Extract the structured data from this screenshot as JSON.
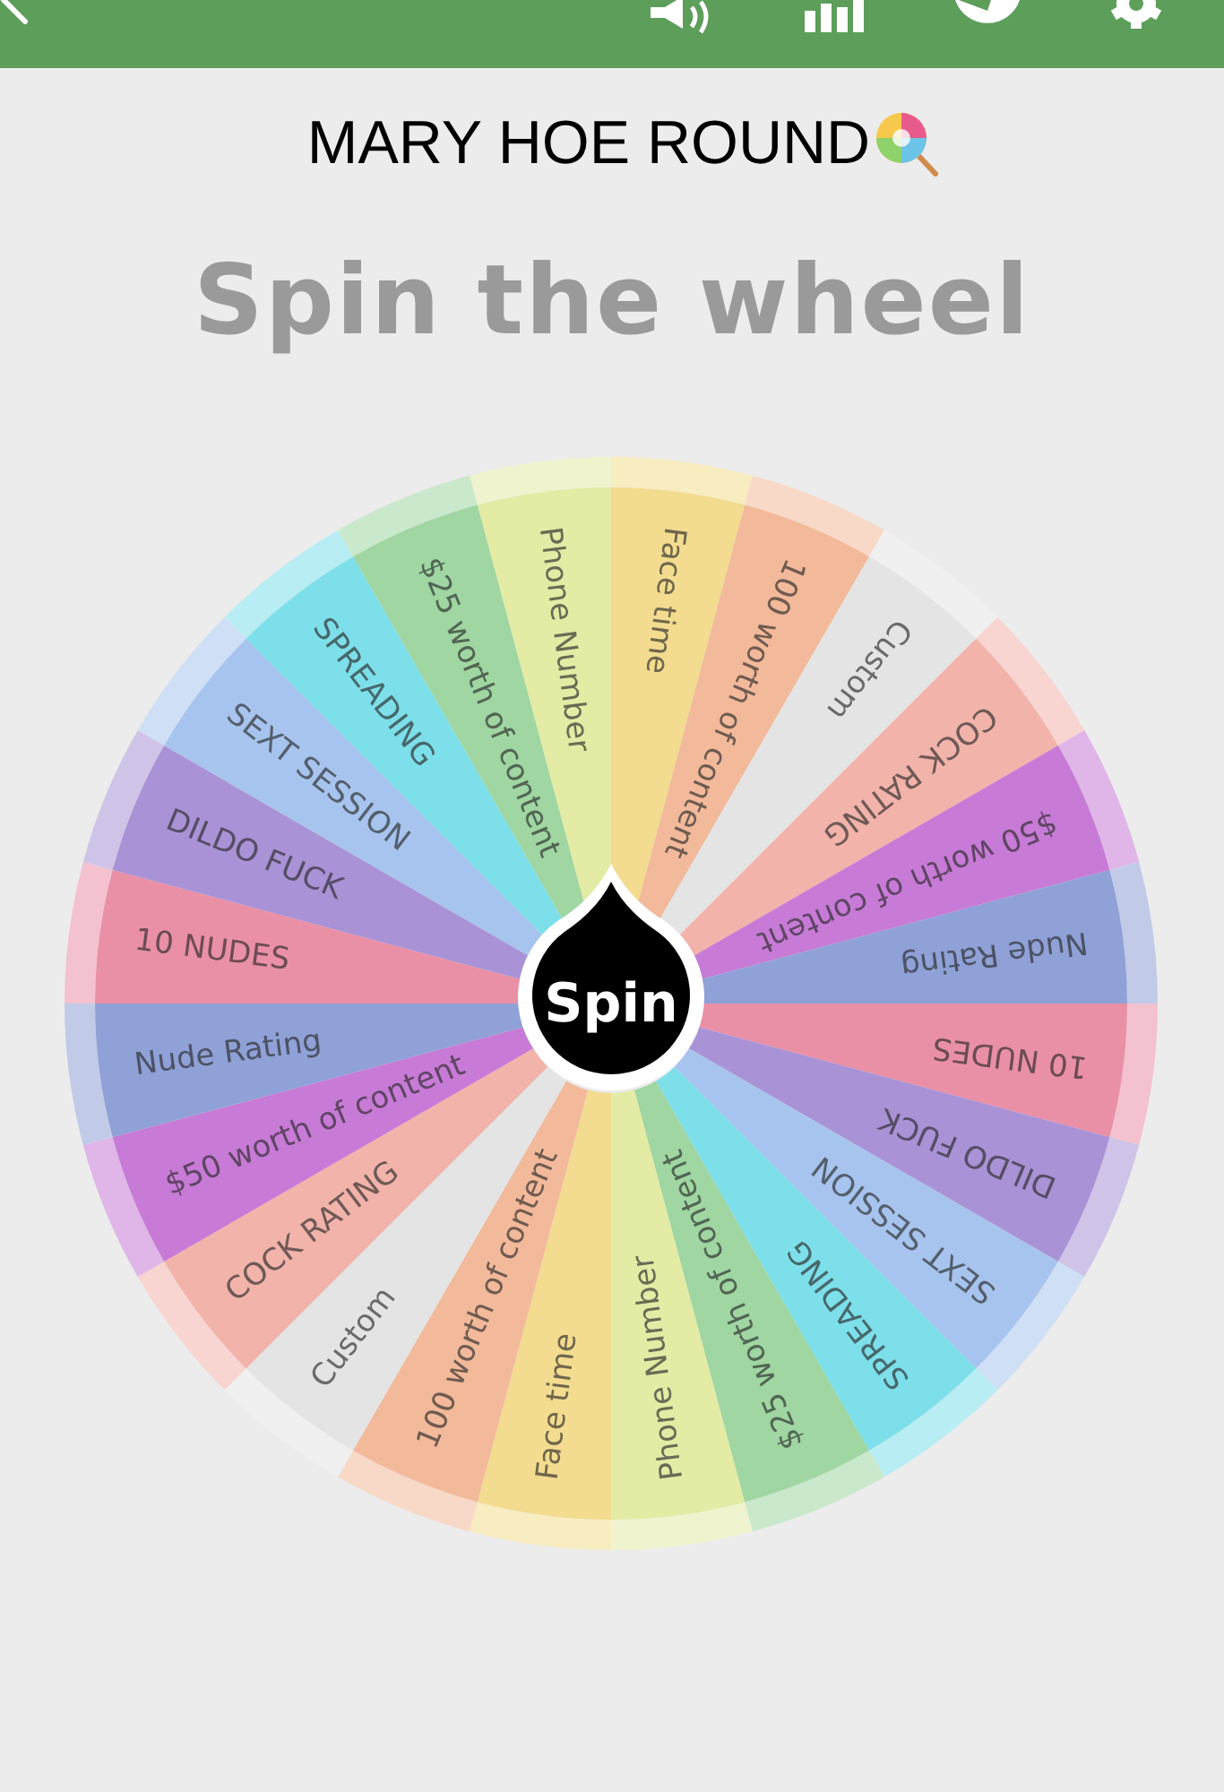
{
  "title": "MARY HOE ROUND",
  "heading": "Spin the wheel",
  "wheel": {
    "button": "Spin",
    "segments": [
      {
        "label": "Face time",
        "color": "#f3dc8f"
      },
      {
        "label": "100 worth of content",
        "color": "#f2b99a"
      },
      {
        "label": "Custom",
        "color": "#e4e4e4"
      },
      {
        "label": "COCK RATING",
        "color": "#f2b3aa"
      },
      {
        "label": "$50 worth of content",
        "color": "#c77bd6"
      },
      {
        "label": "Nude Rating",
        "color": "#8fa1d6"
      },
      {
        "label": "10 NUDES",
        "color": "#ea90a6"
      },
      {
        "label": "DILDO FUCK",
        "color": "#a992d6"
      },
      {
        "label": "SEXT SESSION",
        "color": "#a7c4ee"
      },
      {
        "label": "SPREADING",
        "color": "#7ddfe9"
      },
      {
        "label": "$25 worth of content",
        "color": "#9fd6a2"
      },
      {
        "label": "Phone Number",
        "color": "#e3eba5"
      },
      {
        "label": "Face time",
        "color": "#f3dc8f"
      },
      {
        "label": "100 worth of content",
        "color": "#f2b99a"
      },
      {
        "label": "Custom",
        "color": "#e4e4e4"
      },
      {
        "label": "COCK RATING",
        "color": "#f2b3aa"
      },
      {
        "label": "$50 worth of content",
        "color": "#c77bd6"
      },
      {
        "label": "Nude Rating",
        "color": "#8fa1d6"
      },
      {
        "label": "10 NUDES",
        "color": "#ea90a6"
      },
      {
        "label": "DILDO FUCK",
        "color": "#a992d6"
      },
      {
        "label": "SEXT SESSION",
        "color": "#a7c4ee"
      },
      {
        "label": "SPREADING",
        "color": "#7ddfe9"
      },
      {
        "label": "$25 worth of content",
        "color": "#9fd6a2"
      },
      {
        "label": "Phone Number",
        "color": "#e3eba5"
      }
    ]
  }
}
